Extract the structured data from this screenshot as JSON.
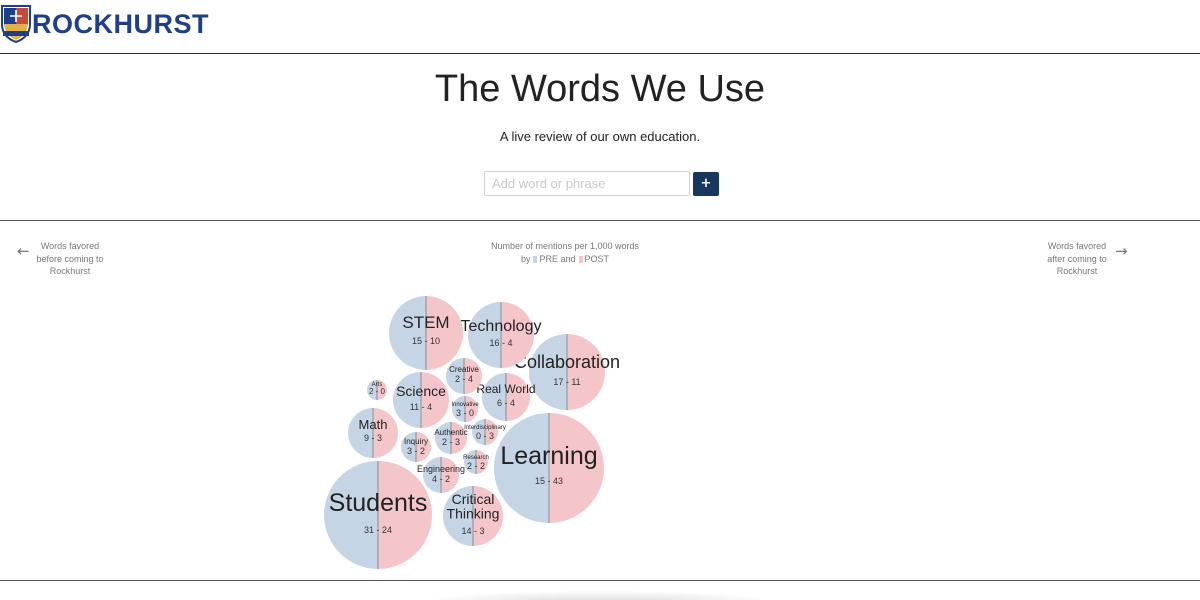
{
  "header": {
    "logo_text": "ROCKHURST"
  },
  "hero": {
    "title": "The Words We Use",
    "subtitle": "A live review of our own education."
  },
  "search": {
    "placeholder": "Add word or phrase",
    "value": "",
    "add_button_label": "+"
  },
  "left_note": {
    "arrow": "←",
    "lines": [
      "Words favored",
      "before coming to",
      "Rockhurst"
    ]
  },
  "right_note": {
    "arrow": "→",
    "lines": [
      "Words favored",
      "after coming to",
      "Rockhurst"
    ]
  },
  "legend": {
    "line1": "Number of mentions per 1,000 words",
    "by": "by",
    "pre_label": "PRE",
    "and": "and",
    "post_label": "POST"
  },
  "colors": {
    "pre": "#c5d5e6",
    "post": "#f5c6c9",
    "divider": "#8b8f96",
    "brand": "#1f3f86",
    "button": "#17375e"
  },
  "chart_data": {
    "type": "bubble",
    "description_of_encoding": "circle area ~ total mentions; left half PRE, right half POST",
    "series": [
      {
        "name": "PRE"
      },
      {
        "name": "POST"
      }
    ],
    "words": [
      {
        "word": "Students",
        "pre": 31,
        "post": 24,
        "label": "31 - 24"
      },
      {
        "word": "Learning",
        "pre": 15,
        "post": 43,
        "label": "15 - 43"
      },
      {
        "word": "Collaboration",
        "pre": 17,
        "post": 11,
        "label": "17 - 11"
      },
      {
        "word": "STEM",
        "pre": 15,
        "post": 10,
        "label": "15 - 10"
      },
      {
        "word": "Technology",
        "pre": 16,
        "post": 4,
        "label": "16 - 4"
      },
      {
        "word": "Critical Thinking",
        "pre": 14,
        "post": 3,
        "label": "14 - 3"
      },
      {
        "word": "Science",
        "pre": 11,
        "post": 4,
        "label": "11 - 4"
      },
      {
        "word": "Math",
        "pre": 9,
        "post": 3,
        "label": "9 - 3"
      },
      {
        "word": "Real World",
        "pre": 6,
        "post": 4,
        "label": "6 - 4"
      },
      {
        "word": "Creative",
        "pre": 2,
        "post": 4,
        "label": "2 - 4"
      },
      {
        "word": "Engineering",
        "pre": 4,
        "post": 2,
        "label": "4 - 2"
      },
      {
        "word": "Inquiry",
        "pre": 3,
        "post": 2,
        "label": "3 - 2"
      },
      {
        "word": "Authentic",
        "pre": 2,
        "post": 3,
        "label": "2 - 3"
      },
      {
        "word": "Interdisciplinary",
        "pre": 0,
        "post": 3,
        "label": "0 - 3"
      },
      {
        "word": "Innovative",
        "pre": 3,
        "post": 0,
        "label": "3 - 0"
      },
      {
        "word": "Research",
        "pre": 2,
        "post": 2,
        "label": "2 - 2"
      },
      {
        "word": "Arts",
        "pre": 2,
        "post": 0,
        "label": "2 - 0"
      }
    ]
  }
}
